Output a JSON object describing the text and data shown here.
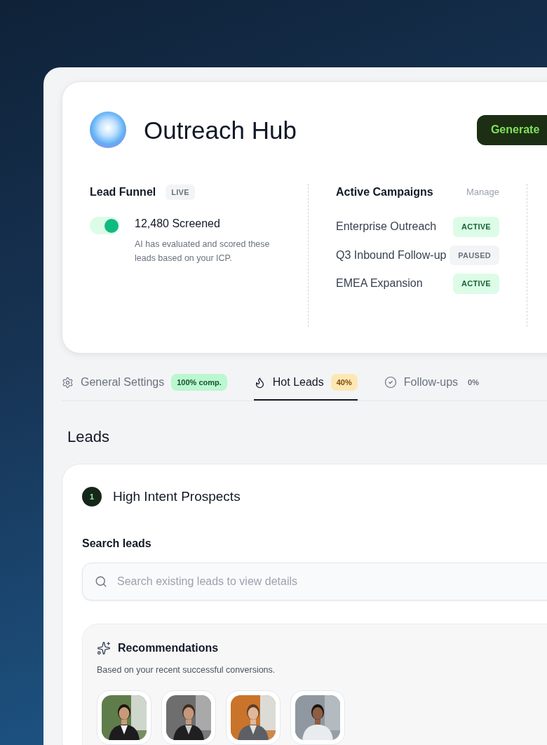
{
  "header": {
    "title": "Outreach Hub",
    "generate_button": "Generate"
  },
  "lead_funnel": {
    "title": "Lead Funnel",
    "badge": "LIVE",
    "toggle_on": true,
    "count": "12,480 Screened",
    "description": "AI has evaluated and scored these leads based on your ICP."
  },
  "campaigns": {
    "title": "Active Campaigns",
    "manage": "Manage",
    "items": [
      {
        "name": "Enterprise Outreach",
        "status": "ACTIVE",
        "kind": "active"
      },
      {
        "name": "Q3 Inbound Follow-up",
        "status": "PAUSED",
        "kind": "paused"
      },
      {
        "name": "EMEA Expansion",
        "status": "ACTIVE",
        "kind": "active"
      }
    ]
  },
  "tabs": [
    {
      "label": "General Settings",
      "badge": "100% comp.",
      "selected": false
    },
    {
      "label": "Hot Leads",
      "badge": "40%",
      "selected": true
    },
    {
      "label": "Follow-ups",
      "badge": "0%",
      "selected": false
    }
  ],
  "section_title": "Leads",
  "step": {
    "number": "1",
    "title": "High Intent Prospects"
  },
  "search": {
    "label": "Search leads",
    "placeholder": "Search existing leads to view details"
  },
  "recommendations": {
    "title": "Recommendations",
    "subtitle": "Based on your recent successful conversions."
  }
}
